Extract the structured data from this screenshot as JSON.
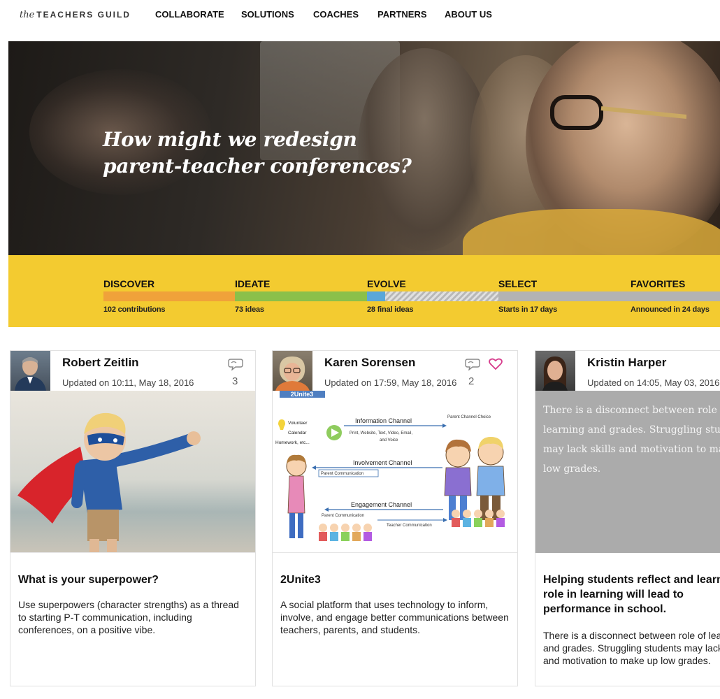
{
  "logo": {
    "the": "the",
    "name": "TEACHERS GUILD"
  },
  "nav": [
    "COLLABORATE",
    "SOLUTIONS",
    "COACHES",
    "PARTNERS",
    "ABOUT US"
  ],
  "hero": {
    "line1": "How might we redesign",
    "line2": "parent-teacher conferences?"
  },
  "phases": [
    {
      "label": "DISCOVER",
      "sub": "102 contributions",
      "color": "#f0a23a"
    },
    {
      "label": "IDEATE",
      "sub": "73 ideas",
      "color": "#8bc04a"
    },
    {
      "label": "EVOLVE",
      "sub": "28 final ideas",
      "color": "#5aa7d9"
    },
    {
      "label": "SELECT",
      "sub": "Starts in 17 days",
      "color": "#b3b3b3"
    },
    {
      "label": "FAVORITES",
      "sub": "Announced in 24 days",
      "color": "#b3b3b3"
    }
  ],
  "cards": [
    {
      "name": "Robert Zeitlin",
      "updated": "Updated on 10:11, May 18, 2016",
      "comments": "3",
      "title": "What is your superpower?",
      "desc": "Use superpowers (character strengths) as a thread to starting P-T communication, including conferences, on a positive vibe."
    },
    {
      "name": "Karen Sorensen",
      "updated": "Updated on 17:59, May 18, 2016",
      "comments": "2",
      "title": "2Unite3",
      "desc": "A social platform that uses technology to inform, involve, and engage better communications between teachers, parents, and students.",
      "diagram": {
        "badge": "2Unite3",
        "left_items": [
          "Volunteer",
          "Calendar",
          "Homework, etc..."
        ],
        "info_channel": "Information Channel",
        "info_sub1": "Print, Website, Text, Video, Email,",
        "info_sub2": "and Voice",
        "parent_choice": "Parent Channel Choice",
        "involvement_channel": "Involvement Channel",
        "parent_comm_1": "Parent Communication",
        "engagement_channel": "Engagement Channel",
        "parent_comm_2": "Parent Communication",
        "teacher_comm": "Teacher Communication"
      }
    },
    {
      "name": "Kristin Harper",
      "updated": "Updated on 14:05, May 03, 2016",
      "preview": "There is a disconnect between role of learning and grades. Struggling students may lack skills and motivation to make up low grades.",
      "title": "Helping students reflect and learn their role in learning will lead to performance in school.",
      "desc": "There is a disconnect between role of learning and grades. Struggling students may lack skills and motivation to make up low grades."
    }
  ]
}
